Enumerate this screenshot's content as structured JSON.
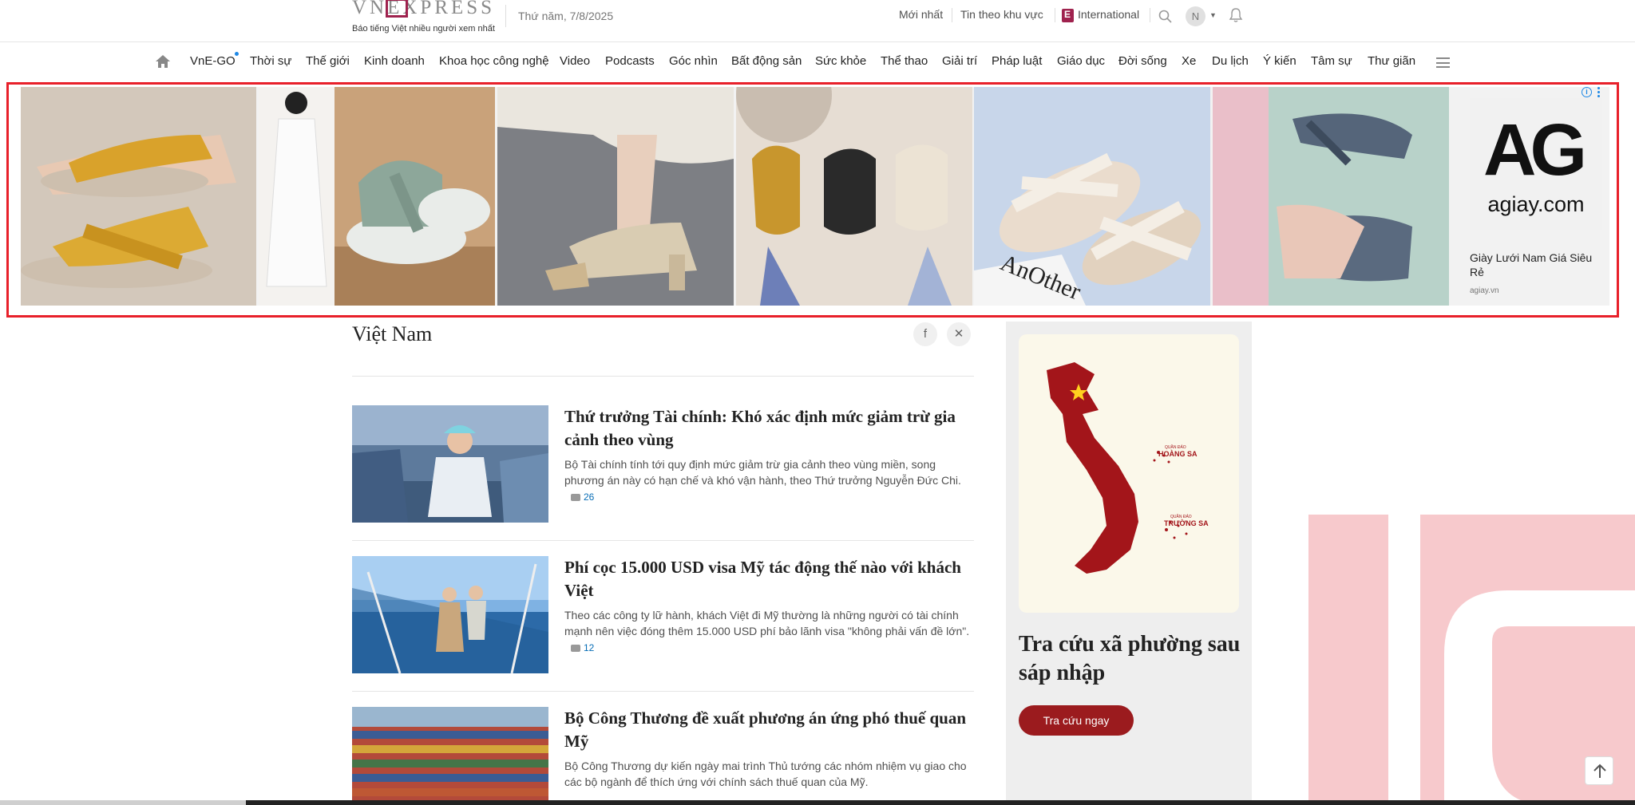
{
  "header": {
    "logo_text": "VNEXPRESS",
    "logo_tagline": "Báo tiếng Việt nhiều người xem nhất",
    "date": "Thứ năm, 7/8/2025",
    "links": [
      "Mới nhất",
      "Tin theo khu vực",
      "International"
    ],
    "avatar_initial": "N"
  },
  "nav": {
    "items": [
      "VnE-GO",
      "Thời sự",
      "Thế giới",
      "Kinh doanh",
      "Khoa học công nghệ",
      "Video",
      "Podcasts",
      "Góc nhìn",
      "Bất động sản",
      "Sức khỏe",
      "Thể thao",
      "Giải trí",
      "Pháp luật",
      "Giáo dục",
      "Đời sống",
      "Xe",
      "Du lịch",
      "Ý kiến",
      "Tâm sự",
      "Thư giãn"
    ]
  },
  "ad": {
    "brand_logo": "AG",
    "brand_domain_logo": "agiay.com",
    "title": "Giày Lưới Nam Giá Siêu Rẻ",
    "domain": "agiay.vn",
    "info_icon": "i",
    "overlay_text": "AnOther"
  },
  "section": {
    "title": "Việt Nam"
  },
  "articles": [
    {
      "title": "Thứ trưởng Tài chính: Khó xác định mức giảm trừ gia cảnh theo vùng",
      "desc": "Bộ Tài chính tính tới quy định mức giảm trừ gia cảnh theo vùng miền, song phương án này có hạn chế và khó vận hành, theo Thứ trưởng Nguyễn Đức Chi.",
      "comments": "26"
    },
    {
      "title": "Phí cọc 15.000 USD visa Mỹ tác động thế nào với khách Việt",
      "desc": "Theo các công ty lữ hành, khách Việt đi Mỹ thường là những người có tài chính mạnh nên việc đóng thêm 15.000 USD phí bảo lãnh visa \"không phải vấn đề lớn\".",
      "comments": "12"
    },
    {
      "title": "Bộ Công Thương đề xuất phương án ứng phó thuế quan Mỹ",
      "desc": "Bộ Công Thương dự kiến ngày mai trình Thủ tướng các nhóm nhiệm vụ giao cho các bộ ngành để thích ứng với chính sách thuế quan của Mỹ.",
      "comments": ""
    }
  ],
  "right_card": {
    "map_labels": [
      "QUẦN ĐẢO",
      "HOÀNG SA",
      "QUẦN ĐẢO",
      "TRƯỜNG SA"
    ],
    "title": "Tra cứu xã phường sau sáp nhập",
    "button": "Tra cứu ngay"
  },
  "colors": {
    "brand": "#9f224e",
    "ad_border": "#e8202a",
    "button": "#9b1b1e",
    "link": "#076db6"
  }
}
